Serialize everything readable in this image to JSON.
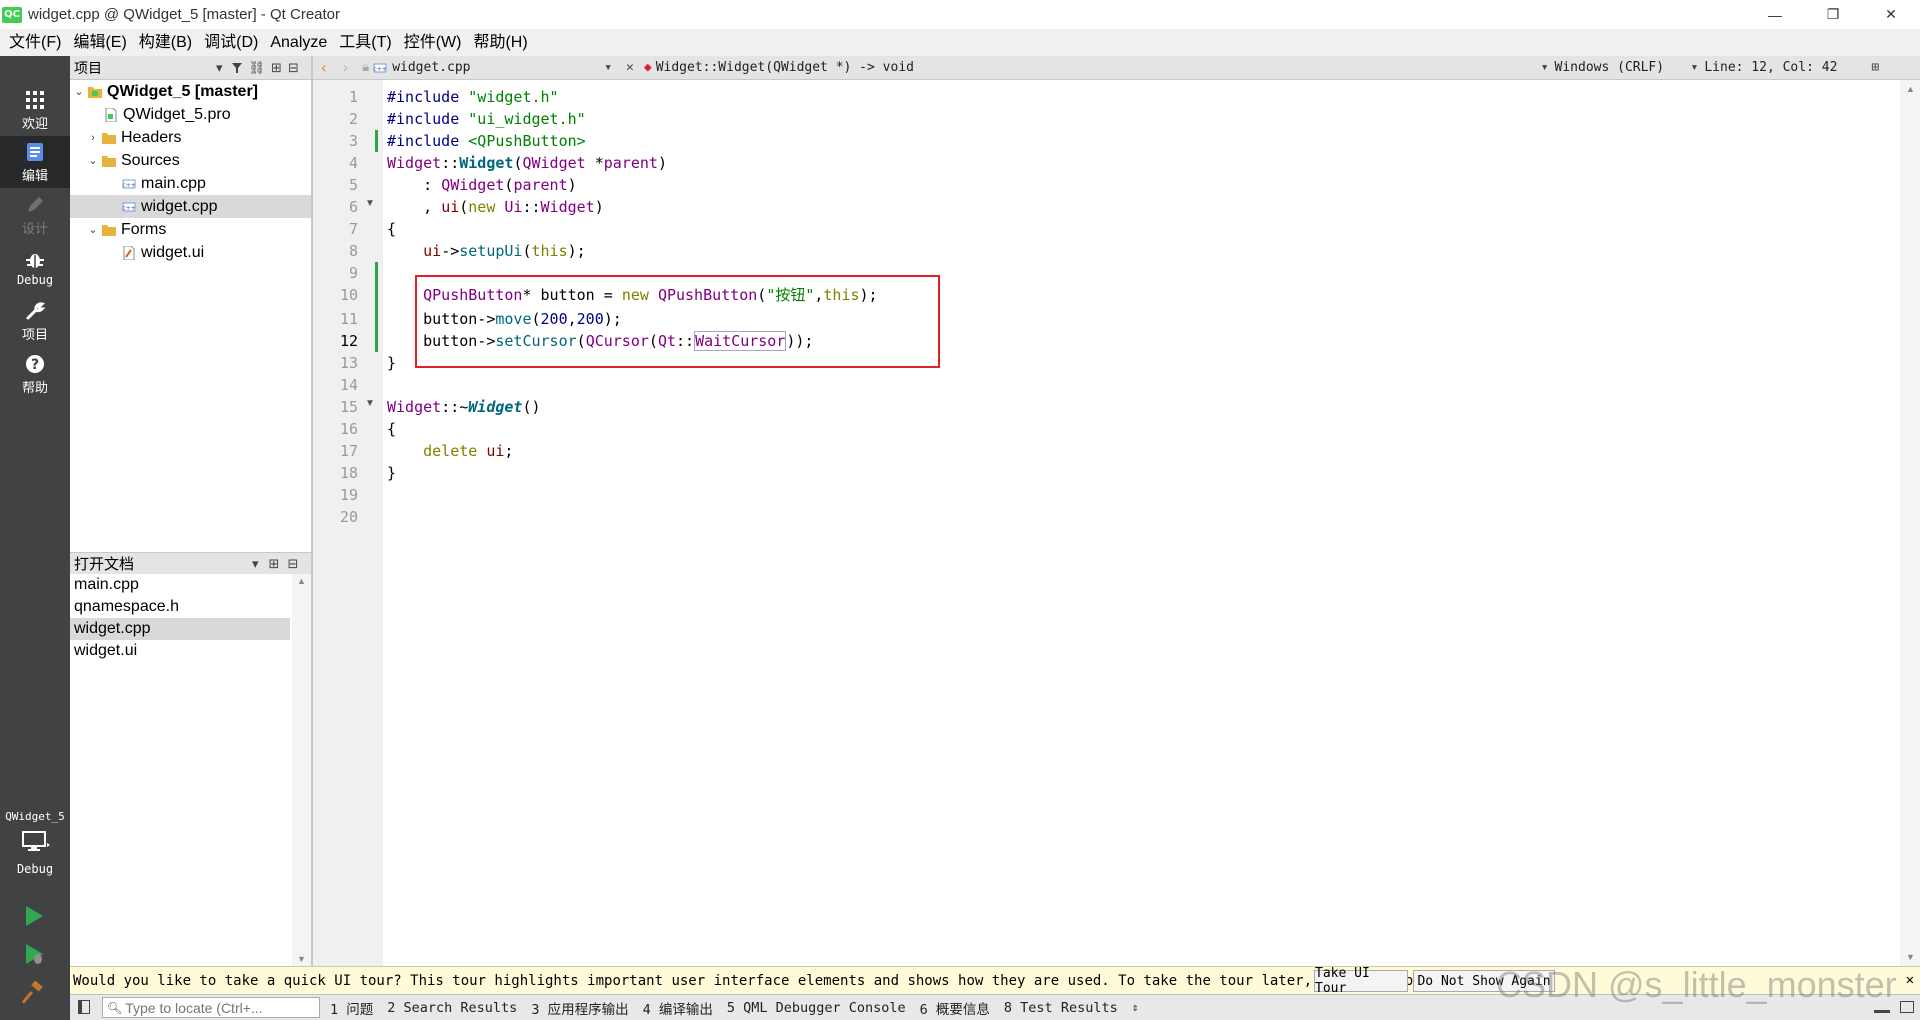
{
  "window": {
    "logo": "QC",
    "title": "widget.cpp @ QWidget_5 [master] - Qt Creator",
    "minimize": "—",
    "maximize": "❐",
    "close": "✕"
  },
  "menu": [
    "文件(F)",
    "编辑(E)",
    "构建(B)",
    "调试(D)",
    "Analyze",
    "工具(T)",
    "控件(W)",
    "帮助(H)"
  ],
  "modes": {
    "welcome": "欢迎",
    "edit": "编辑",
    "design": "设计",
    "debug": "Debug",
    "projects": "项目",
    "help": "帮助",
    "target_project": "QWidget_5",
    "target_config": "Debug"
  },
  "project_panel": {
    "header": "项目",
    "tree": {
      "project": "QWidget_5 [master]",
      "pro_file": "QWidget_5.pro",
      "headers": "Headers",
      "sources": "Sources",
      "main_cpp": "main.cpp",
      "widget_cpp": "widget.cpp",
      "forms": "Forms",
      "widget_ui": "widget.ui"
    }
  },
  "open_docs": {
    "header": "打开文档",
    "items": [
      "main.cpp",
      "qnamespace.h",
      "widget.cpp",
      "widget.ui"
    ]
  },
  "editor_toolbar": {
    "file": "widget.cpp",
    "symbol": "Widget::Widget(QWidget *) -> void",
    "line_ending": "Windows (CRLF)",
    "position": "Line: 12, Col: 42"
  },
  "editor": {
    "line_numbers": [
      "1",
      "2",
      "3",
      "4",
      "5",
      "6",
      "7",
      "8",
      "9",
      "10",
      "11",
      "12",
      "13",
      "14",
      "15",
      "16",
      "17",
      "18",
      "19",
      "20"
    ],
    "current_line": "12"
  },
  "code": {
    "l1_pp": "#include ",
    "l1_str": "\"widget.h\"",
    "l2_pp": "#include ",
    "l2_str": "\"ui_widget.h\"",
    "l3_pp": "#include ",
    "l3_str": "<QPushButton>",
    "l4_type": "Widget",
    "l4_sep": "::",
    "l4_fn": "Widget",
    "l4_open": "(",
    "l4_type2": "QWidget",
    "l4_rest": " *",
    "l4_param": "parent",
    "l4_close": ")",
    "l5_pre": "    : ",
    "l5_type": "QWidget",
    "l5_open": "(",
    "l5_param": "parent",
    "l5_close": ")",
    "l6_pre": "    , ",
    "l6_field": "ui",
    "l6_open": "(",
    "l6_kw": "new",
    "l6_sp": " ",
    "l6_type": "Ui",
    "l6_sep": "::",
    "l6_type2": "Widget",
    "l6_close": ")",
    "l7": "{",
    "l8_pre": "    ",
    "l8_field": "ui",
    "l8_arrow": "->",
    "l8_fn": "setupUi",
    "l8_open": "(",
    "l8_kw": "this",
    "l8_close": ");",
    "l10_pre": "    ",
    "l10_type": "QPushButton",
    "l10_mid": "* button = ",
    "l10_kw": "new",
    "l10_sp": " ",
    "l10_type2": "QPushButton",
    "l10_open": "(",
    "l10_str": "\"按钮\"",
    "l10_comma": ",",
    "l10_kw2": "this",
    "l10_close": ");",
    "l11_pre": "    button->",
    "l11_fn": "move",
    "l11_open": "(",
    "l11_n1": "200",
    "l11_comma": ",",
    "l11_n2": "200",
    "l11_close": ");",
    "l12_pre": "    button->",
    "l12_fn": "setCursor",
    "l12_open": "(",
    "l12_type": "QCursor",
    "l12_open2": "(",
    "l12_ns": "Qt",
    "l12_sep": "::",
    "l12_enum": "WaitCursor",
    "l12_close": "));",
    "l13": "}",
    "l15_type": "Widget",
    "l15_sep": "::~",
    "l15_fn": "Widget",
    "l15_close": "()",
    "l16": "{",
    "l17_pre": "    ",
    "l17_kw": "delete",
    "l17_sp": " ",
    "l17_field": "ui",
    "l17_semi": ";",
    "l18": "}"
  },
  "tour": {
    "message": "Would you like to take a quick UI tour? This tour highlights important user interface elements and shows how they are used. To take the tour later, select Help > UI Tour.",
    "take_tour": "Take UI Tour",
    "dont_show": "Do Not Show Again"
  },
  "statusbar": {
    "locator_placeholder": "Type to locate (Ctrl+...",
    "tabs": [
      "1 问题",
      "2 Search Results",
      "3 应用程序输出",
      "4 编译输出",
      "5 QML Debugger Console",
      "6 概要信息",
      "8 Test Results"
    ]
  },
  "watermark": "CSDN @s_little_monster",
  "colors": {
    "mode_bar": "#404244",
    "highlight_box": "#e0212a",
    "run_green": "#2fa84f"
  }
}
